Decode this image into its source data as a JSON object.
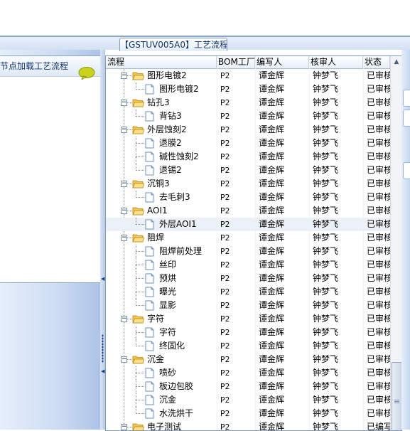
{
  "window": {
    "title": "【GSTUV005A0】工艺流程"
  },
  "left_panel": {
    "header_text": "节点加载工艺流程",
    "icon": "chat-bubble-icon"
  },
  "grid": {
    "columns": {
      "process": "流程",
      "bom": "BOM工厂",
      "writer": "编写人",
      "reviewer": "核审人",
      "status": "状态"
    },
    "rows": [
      {
        "level": 1,
        "type": "folder",
        "name": "图形电镀2",
        "bom": "P2",
        "writer": "谭金辉",
        "reviewer": "钟梦飞",
        "status": "已审核"
      },
      {
        "level": 2,
        "type": "doc",
        "name": "图形电镀2",
        "bom": "P2",
        "writer": "谭金辉",
        "reviewer": "钟梦飞",
        "status": "已审核"
      },
      {
        "level": 1,
        "type": "folder",
        "name": "钻孔3",
        "bom": "P2",
        "writer": "谭金辉",
        "reviewer": "钟梦飞",
        "status": "已审核"
      },
      {
        "level": 2,
        "type": "doc",
        "name": "背钻3",
        "bom": "P2",
        "writer": "谭金辉",
        "reviewer": "钟梦飞",
        "status": "已审核"
      },
      {
        "level": 1,
        "type": "folder",
        "name": "外层蚀刻2",
        "bom": "P2",
        "writer": "谭金辉",
        "reviewer": "钟梦飞",
        "status": "已审核"
      },
      {
        "level": 2,
        "type": "doc",
        "name": "退膜2",
        "bom": "P2",
        "writer": "谭金辉",
        "reviewer": "钟梦飞",
        "status": "已审核"
      },
      {
        "level": 2,
        "type": "doc",
        "name": "碱性蚀刻2",
        "bom": "P2",
        "writer": "谭金辉",
        "reviewer": "钟梦飞",
        "status": "已审核"
      },
      {
        "level": 2,
        "type": "doc",
        "name": "退锡2",
        "bom": "P2",
        "writer": "谭金辉",
        "reviewer": "钟梦飞",
        "status": "已审核"
      },
      {
        "level": 1,
        "type": "folder",
        "name": "沉铜3",
        "bom": "P2",
        "writer": "谭金辉",
        "reviewer": "钟梦飞",
        "status": "已审核"
      },
      {
        "level": 2,
        "type": "doc",
        "name": "去毛刺3",
        "bom": "P2",
        "writer": "谭金辉",
        "reviewer": "钟梦飞",
        "status": "已审核"
      },
      {
        "level": 1,
        "type": "folder",
        "name": "AOI1",
        "bom": "P2",
        "writer": "谭金辉",
        "reviewer": "钟梦飞",
        "status": "已审核"
      },
      {
        "level": 2,
        "type": "doc",
        "name": "外层AOI1",
        "bom": "P2",
        "writer": "谭金辉",
        "reviewer": "钟梦飞",
        "status": "已审核",
        "selected": true
      },
      {
        "level": 1,
        "type": "folder",
        "name": "阻焊",
        "bom": "P2",
        "writer": "谭金辉",
        "reviewer": "钟梦飞",
        "status": "已审核"
      },
      {
        "level": 2,
        "type": "doc",
        "name": "阻焊前处理",
        "bom": "P2",
        "writer": "谭金辉",
        "reviewer": "钟梦飞",
        "status": "已审核"
      },
      {
        "level": 2,
        "type": "doc",
        "name": "丝印",
        "bom": "P2",
        "writer": "谭金辉",
        "reviewer": "钟梦飞",
        "status": "已审核"
      },
      {
        "level": 2,
        "type": "doc",
        "name": "预烘",
        "bom": "P2",
        "writer": "谭金辉",
        "reviewer": "钟梦飞",
        "status": "已审核"
      },
      {
        "level": 2,
        "type": "doc",
        "name": "曝光",
        "bom": "P2",
        "writer": "谭金辉",
        "reviewer": "钟梦飞",
        "status": "已审核"
      },
      {
        "level": 2,
        "type": "doc",
        "name": "显影",
        "bom": "P2",
        "writer": "谭金辉",
        "reviewer": "钟梦飞",
        "status": "已审核"
      },
      {
        "level": 1,
        "type": "folder",
        "name": "字符",
        "bom": "P2",
        "writer": "谭金辉",
        "reviewer": "钟梦飞",
        "status": "已审核"
      },
      {
        "level": 2,
        "type": "doc",
        "name": "字符",
        "bom": "P2",
        "writer": "谭金辉",
        "reviewer": "钟梦飞",
        "status": "已审核"
      },
      {
        "level": 2,
        "type": "doc",
        "name": "终固化",
        "bom": "P2",
        "writer": "谭金辉",
        "reviewer": "钟梦飞",
        "status": "已审核"
      },
      {
        "level": 1,
        "type": "folder",
        "name": "沉金",
        "bom": "P2",
        "writer": "谭金辉",
        "reviewer": "钟梦飞",
        "status": "已审核"
      },
      {
        "level": 2,
        "type": "doc",
        "name": "喷砂",
        "bom": "P2",
        "writer": "谭金辉",
        "reviewer": "钟梦飞",
        "status": "已审核"
      },
      {
        "level": 2,
        "type": "doc",
        "name": "板边包胶",
        "bom": "P2",
        "writer": "谭金辉",
        "reviewer": "钟梦飞",
        "status": "已审核"
      },
      {
        "level": 2,
        "type": "doc",
        "name": "沉金",
        "bom": "P2",
        "writer": "谭金辉",
        "reviewer": "钟梦飞",
        "status": "已审核"
      },
      {
        "level": 2,
        "type": "doc",
        "name": "水洗烘干",
        "bom": "P2",
        "writer": "谭金辉",
        "reviewer": "钟梦飞",
        "status": "已审核"
      },
      {
        "level": 1,
        "type": "folder",
        "name": "电子测试",
        "bom": "P2",
        "writer": "谭金辉",
        "reviewer": "钟梦飞",
        "status": "已编写"
      }
    ]
  },
  "colors": {
    "header_text": "#10346b",
    "folder": "#f2c44d",
    "doc_border": "#6b8fbf",
    "selected_row": "#ecf1f8"
  }
}
